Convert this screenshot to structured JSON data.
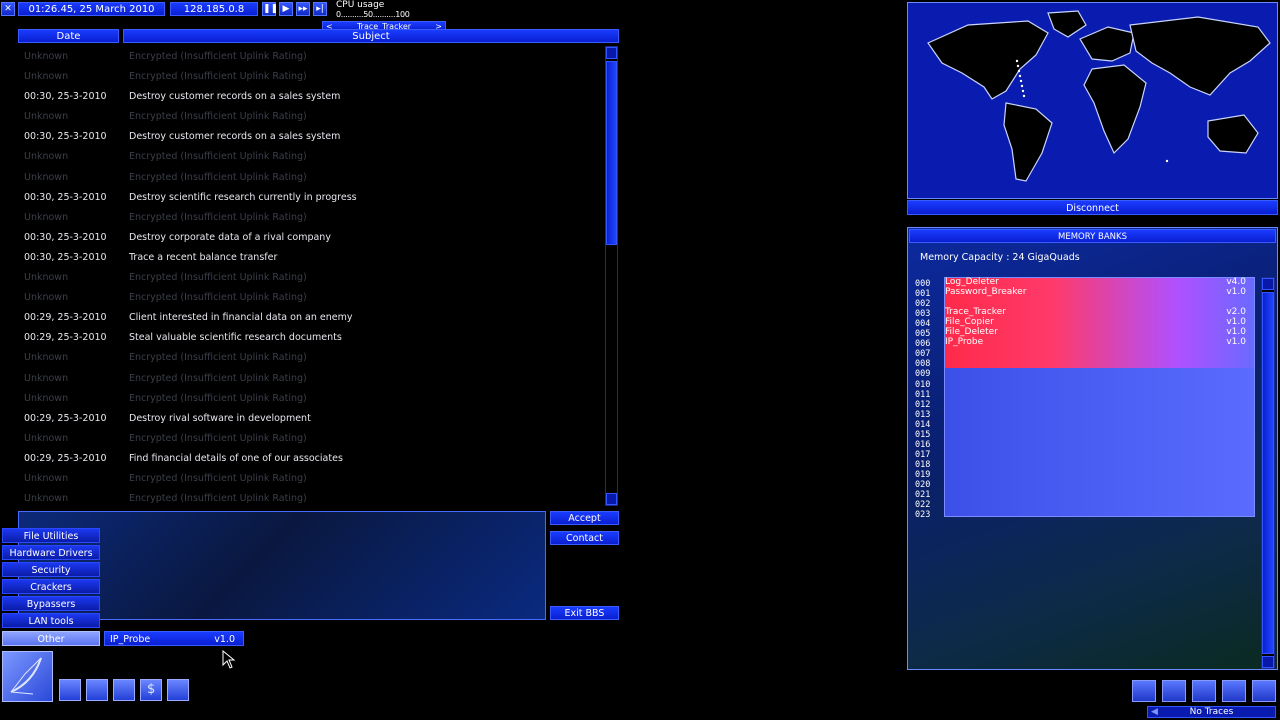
{
  "topbar": {
    "datetime": "01:26.45, 25 March 2010",
    "ip": "128.185.0.8",
    "cpu_label": "CPU usage",
    "cpu_scale": "0..........50..........100",
    "cpu_task_prev": "<",
    "cpu_task": "Trace_Tracker",
    "cpu_task_next": ">",
    "media_icons": [
      "pause-icon",
      "play-icon",
      "fast-forward-icon",
      "skip-icon"
    ]
  },
  "bbs": {
    "col_date": "Date",
    "col_subject": "Subject",
    "messages": [
      {
        "date": "Unknown",
        "subject": "Encrypted (Insufficient Uplink Rating)",
        "encrypted": true
      },
      {
        "date": "Unknown",
        "subject": "Encrypted (Insufficient Uplink Rating)",
        "encrypted": true
      },
      {
        "date": "00:30, 25-3-2010",
        "subject": "Destroy customer records on a sales system",
        "encrypted": false
      },
      {
        "date": "Unknown",
        "subject": "Encrypted (Insufficient Uplink Rating)",
        "encrypted": true
      },
      {
        "date": "00:30, 25-3-2010",
        "subject": "Destroy customer records on a sales system",
        "encrypted": false
      },
      {
        "date": "Unknown",
        "subject": "Encrypted (Insufficient Uplink Rating)",
        "encrypted": true
      },
      {
        "date": "Unknown",
        "subject": "Encrypted (Insufficient Uplink Rating)",
        "encrypted": true
      },
      {
        "date": "00:30, 25-3-2010",
        "subject": "Destroy scientific research currently in progress",
        "encrypted": false
      },
      {
        "date": "Unknown",
        "subject": "Encrypted (Insufficient Uplink Rating)",
        "encrypted": true
      },
      {
        "date": "00:30, 25-3-2010",
        "subject": "Destroy corporate data of a rival company",
        "encrypted": false
      },
      {
        "date": "00:30, 25-3-2010",
        "subject": "Trace a recent balance transfer",
        "encrypted": false
      },
      {
        "date": "Unknown",
        "subject": "Encrypted (Insufficient Uplink Rating)",
        "encrypted": true
      },
      {
        "date": "Unknown",
        "subject": "Encrypted (Insufficient Uplink Rating)",
        "encrypted": true
      },
      {
        "date": "00:29, 25-3-2010",
        "subject": "Client interested in financial data on an enemy",
        "encrypted": false
      },
      {
        "date": "00:29, 25-3-2010",
        "subject": "Steal valuable scientific research documents",
        "encrypted": false
      },
      {
        "date": "Unknown",
        "subject": "Encrypted (Insufficient Uplink Rating)",
        "encrypted": true
      },
      {
        "date": "Unknown",
        "subject": "Encrypted (Insufficient Uplink Rating)",
        "encrypted": true
      },
      {
        "date": "Unknown",
        "subject": "Encrypted (Insufficient Uplink Rating)",
        "encrypted": true
      },
      {
        "date": "00:29, 25-3-2010",
        "subject": "Destroy rival software in development",
        "encrypted": false
      },
      {
        "date": "Unknown",
        "subject": "Encrypted (Insufficient Uplink Rating)",
        "encrypted": true
      },
      {
        "date": "00:29, 25-3-2010",
        "subject": "Find financial details of one of our associates",
        "encrypted": false
      },
      {
        "date": "Unknown",
        "subject": "Encrypted (Insufficient Uplink Rating)",
        "encrypted": true
      },
      {
        "date": "Unknown",
        "subject": "Encrypted (Insufficient Uplink Rating)",
        "encrypted": true
      }
    ],
    "accept": "Accept",
    "contact": "Contact",
    "exit": "Exit BBS"
  },
  "software_menu": {
    "items": [
      "File Utilities",
      "Hardware Drivers",
      "Security",
      "Crackers",
      "Bypassers",
      "LAN tools",
      "Other"
    ],
    "selected": "Other",
    "submenu_name": "IP_Probe",
    "submenu_version": "v1.0"
  },
  "map": {
    "disconnect": "Disconnect"
  },
  "memory": {
    "title": "MEMORY BANKS",
    "capacity": "Memory Capacity : 24 GigaQuads",
    "slots": [
      "000",
      "001",
      "002",
      "003",
      "004",
      "005",
      "006",
      "007",
      "008",
      "009",
      "010",
      "011",
      "012",
      "013",
      "014",
      "015",
      "016",
      "017",
      "018",
      "019",
      "020",
      "021",
      "022",
      "023"
    ],
    "files": [
      {
        "slot": 0,
        "name": "Log_Deleter",
        "version": "v4.0"
      },
      {
        "slot": 1,
        "name": "Password_Breaker",
        "version": "v1.0"
      },
      {
        "slot": 3,
        "name": "Trace_Tracker",
        "version": "v2.0"
      },
      {
        "slot": 4,
        "name": "File_Copier",
        "version": "v1.0"
      },
      {
        "slot": 5,
        "name": "File_Deleter",
        "version": "v1.0"
      },
      {
        "slot": 6,
        "name": "IP_Probe",
        "version": "v1.0"
      }
    ]
  },
  "status": {
    "traces": "No Traces"
  },
  "colors": {
    "accent": "#1a3cff",
    "memory_used": "#ff2a55",
    "panel_bg": "#0a1a6a"
  }
}
